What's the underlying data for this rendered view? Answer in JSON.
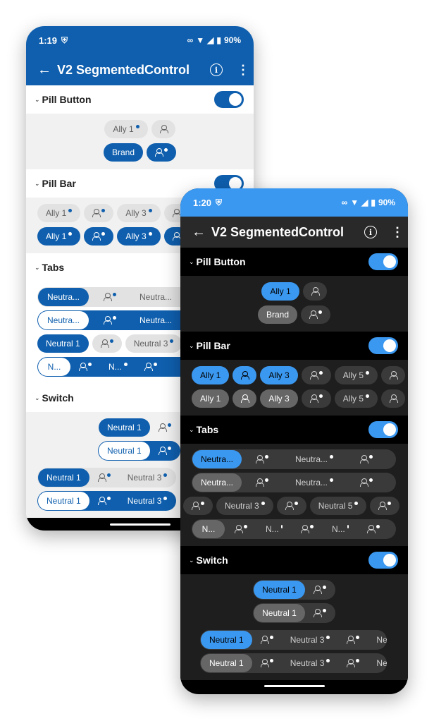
{
  "light": {
    "status": {
      "time": "1:19",
      "battery": "90%"
    },
    "appbar": {
      "title": "V2 SegmentedControl",
      "info": "i",
      "more": "⋮",
      "back": "←"
    },
    "sections": {
      "pill_button": {
        "label": "Pill Button"
      },
      "pill_bar": {
        "label": "Pill Bar"
      },
      "tabs": {
        "label": "Tabs"
      },
      "switch": {
        "label": "Switch"
      }
    },
    "pill_button": {
      "ally": "Ally 1",
      "brand": "Brand"
    },
    "pill_bar": {
      "ally1": "Ally 1",
      "ally3": "Ally 3"
    },
    "tabs": {
      "row1": {
        "a": "Neutra...",
        "b": "Neutra..."
      },
      "row2": {
        "a": "Neutra...",
        "b": "Neutra..."
      },
      "row3": {
        "a": "Neutral 1",
        "b": "Neutral 3"
      },
      "row4": {
        "a": "N...",
        "b": "N..."
      }
    },
    "switch": {
      "n1": "Neutral 1",
      "n3": "Neutral 3"
    }
  },
  "dark": {
    "status": {
      "time": "1:20",
      "battery": "90%"
    },
    "appbar": {
      "title": "V2 SegmentedControl",
      "info": "i",
      "more": "⋮",
      "back": "←"
    },
    "sections": {
      "pill_button": {
        "label": "Pill Button"
      },
      "pill_bar": {
        "label": "Pill Bar"
      },
      "tabs": {
        "label": "Tabs"
      },
      "switch": {
        "label": "Switch"
      }
    },
    "pill_button": {
      "ally": "Ally 1",
      "brand": "Brand"
    },
    "pill_bar": {
      "ally1": "Ally 1",
      "ally3": "Ally 3",
      "ally5": "Ally 5"
    },
    "tabs": {
      "row1": {
        "a": "Neutra...",
        "b": "Neutra..."
      },
      "row2": {
        "a": "Neutra...",
        "b": "Neutra..."
      },
      "row3": {
        "a": "Neutral 3",
        "b": "Neutral 5"
      },
      "row4": {
        "a": "N...",
        "b": "N...",
        "c": "N..."
      }
    },
    "switch": {
      "n1": "Neutral 1",
      "n3": "Neutral 3",
      "ne": "Ne"
    }
  },
  "colors": {
    "brand": "#0f5fae",
    "dark_accent": "#3b98f0"
  }
}
